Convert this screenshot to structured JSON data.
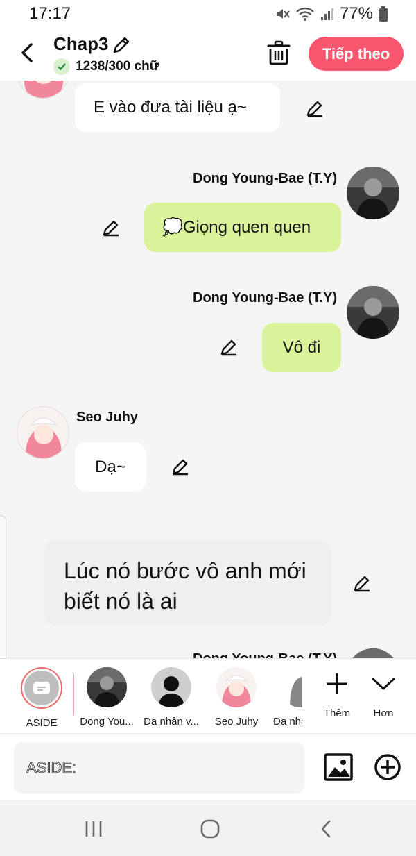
{
  "status_bar": {
    "time": "17:17",
    "battery": "77%"
  },
  "header": {
    "title": "Chap3",
    "word_count": "1238/300 chữ",
    "next_label": "Tiếp theo"
  },
  "chat": {
    "messages": [
      {
        "text": "E vào đưa tài liệu ạ~"
      },
      {
        "sender": "Dong Young-Bae (T.Y)",
        "text": "💭Giọng quen quen"
      },
      {
        "sender": "Dong Young-Bae (T.Y)",
        "text": "Vô đi"
      },
      {
        "sender": "Seo Juhy",
        "text": "Dạ~"
      },
      {
        "text": "Lúc nó bước vô anh mới biết nó là ai"
      },
      {
        "sender": "Dong Young-Bae (T.Y)"
      }
    ]
  },
  "characters": [
    {
      "label": "ASIDE"
    },
    {
      "label": "Dong You..."
    },
    {
      "label": "Đa nhân v..."
    },
    {
      "label": "Seo Juhy"
    },
    {
      "label": "Đa nhâ"
    }
  ],
  "bar_actions": {
    "add_label": "Thêm",
    "more_label": "Hơn"
  },
  "input": {
    "placeholder": "ASIDE:"
  }
}
